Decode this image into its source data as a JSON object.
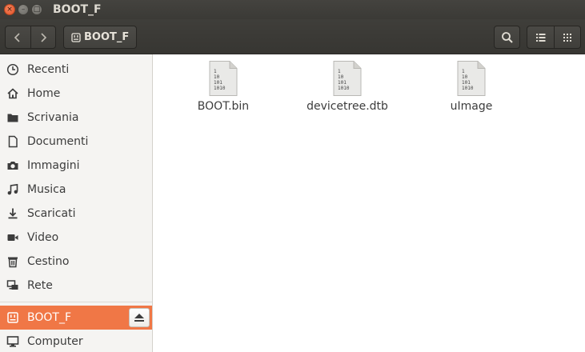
{
  "window": {
    "title": "BOOT_F"
  },
  "titlebar": {
    "close_glyph": "×",
    "minimize_glyph": "–",
    "maximize_glyph": "□"
  },
  "header": {
    "path_label": "BOOT_F",
    "back_icon": "chevron-left-icon",
    "forward_icon": "chevron-right-icon",
    "search_icon": "search-icon",
    "list_view_icon": "list-view-icon",
    "grid_view_icon": "grid-view-icon"
  },
  "sidebar": {
    "items": [
      {
        "label": "Recenti",
        "icon": "clock-icon"
      },
      {
        "label": "Home",
        "icon": "home-icon"
      },
      {
        "label": "Scrivania",
        "icon": "folder-icon"
      },
      {
        "label": "Documenti",
        "icon": "document-icon"
      },
      {
        "label": "Immagini",
        "icon": "camera-icon"
      },
      {
        "label": "Musica",
        "icon": "music-icon"
      },
      {
        "label": "Scaricati",
        "icon": "download-icon"
      },
      {
        "label": "Video",
        "icon": "video-icon"
      },
      {
        "label": "Cestino",
        "icon": "trash-icon"
      },
      {
        "label": "Rete",
        "icon": "network-icon"
      }
    ],
    "devices": [
      {
        "label": "BOOT_F",
        "icon": "drive-icon",
        "active": true,
        "eject": true
      },
      {
        "label": "Computer",
        "icon": "computer-icon"
      }
    ]
  },
  "files": [
    {
      "name": "BOOT.bin",
      "icon": "binary-file-icon",
      "binary_lines": [
        "1",
        "10",
        "101",
        "1010"
      ]
    },
    {
      "name": "devicetree.dtb",
      "icon": "binary-file-icon",
      "binary_lines": [
        "1",
        "10",
        "101",
        "1010"
      ]
    },
    {
      "name": "uImage",
      "icon": "binary-file-icon",
      "binary_lines": [
        "1",
        "10",
        "101",
        "1010"
      ]
    }
  ],
  "colors": {
    "accent": "#f07746",
    "titlebar": "#3f3e3a",
    "sidebar_bg": "#f5f4f2"
  }
}
